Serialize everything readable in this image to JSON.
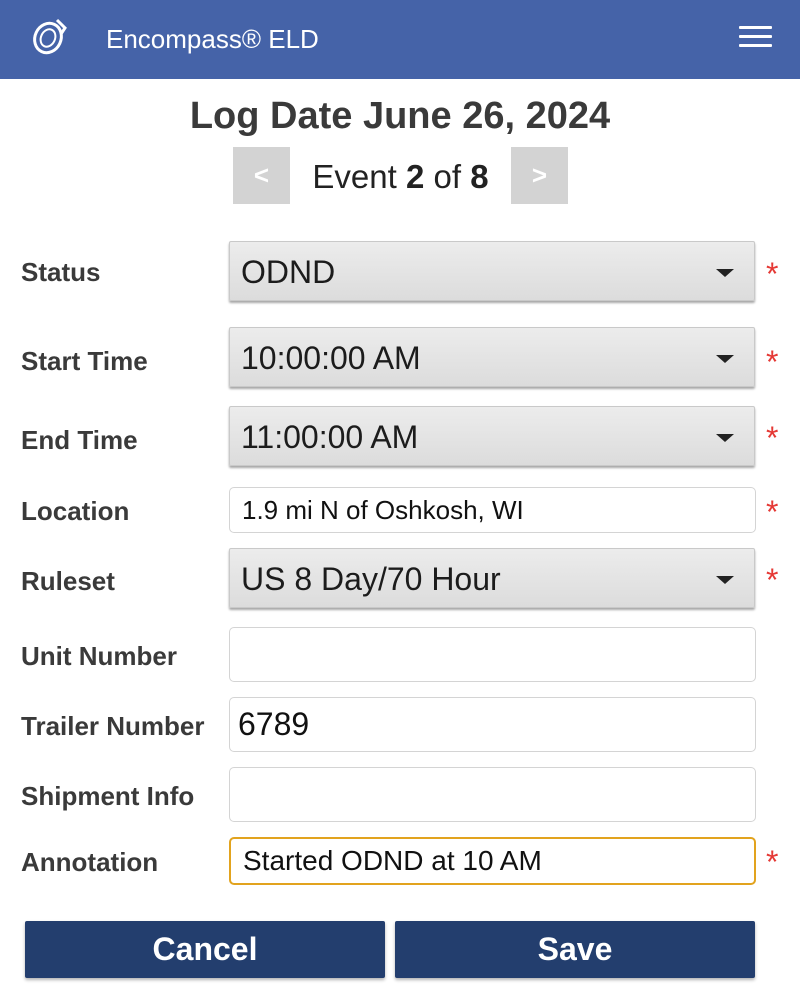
{
  "app": {
    "title": "Encompass® ELD",
    "logo_icon": "encompass-logo-icon",
    "menu_icon": "hamburger-menu-icon"
  },
  "header": {
    "log_date": "Log Date June 26, 2024"
  },
  "event_nav": {
    "prev_label": "<",
    "next_label": ">",
    "prefix": "Event ",
    "current": "2",
    "separator": " of ",
    "total": "8"
  },
  "form": {
    "status": {
      "label": "Status",
      "value": "ODND",
      "required_mark": "*"
    },
    "start_time": {
      "label": "Start Time",
      "value": "10:00:00 AM",
      "required_mark": "*"
    },
    "end_time": {
      "label": "End Time",
      "value": "11:00:00 AM",
      "required_mark": "*"
    },
    "location": {
      "label": "Location",
      "value": "1.9 mi N of Oshkosh, WI",
      "required_mark": "*"
    },
    "ruleset": {
      "label": "Ruleset",
      "value": "US 8 Day/70 Hour",
      "required_mark": "*"
    },
    "unit_number": {
      "label": "Unit Number",
      "value": ""
    },
    "trailer_number": {
      "label": "Trailer Number",
      "value": "6789"
    },
    "shipment_info": {
      "label": "Shipment Info",
      "value": ""
    },
    "annotation": {
      "label": "Annotation",
      "value": "Started ODND at 10 AM",
      "required_mark": "*"
    }
  },
  "actions": {
    "cancel_label": "Cancel",
    "save_label": "Save"
  },
  "colors": {
    "header_bg": "#4563a8",
    "button_bg": "#233e6e",
    "required": "#e53935",
    "focus_border": "#e2a31e",
    "nav_button_bg": "#d3d3d3"
  }
}
